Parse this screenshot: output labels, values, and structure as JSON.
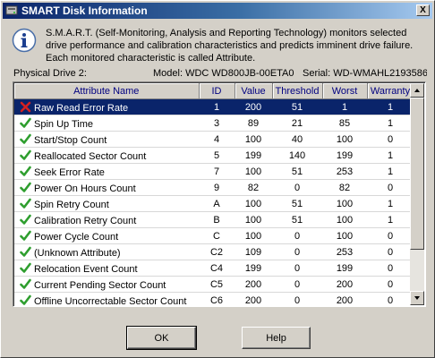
{
  "window": {
    "title": "SMART Disk Information",
    "close_label": "X"
  },
  "description": "S.M.A.R.T. (Self-Monitoring, Analysis and Reporting Technology) monitors selected drive performance and calibration characteristics and predicts imminent drive failure. Each monitored characteristic is called Attribute.",
  "drive": {
    "label": "Physical Drive 2:",
    "model": "Model: WDC WD800JB-00ETA0",
    "serial": "Serial: WD-WMAHL2193586"
  },
  "table": {
    "headers": [
      "Attribute Name",
      "ID",
      "Value",
      "Threshold",
      "Worst",
      "Warranty"
    ],
    "rows": [
      {
        "status": "error",
        "name": "Raw Read Error Rate",
        "id": "1",
        "value": "200",
        "threshold": "51",
        "worst": "1",
        "warranty": "1"
      },
      {
        "status": "ok",
        "name": "Spin Up Time",
        "id": "3",
        "value": "89",
        "threshold": "21",
        "worst": "85",
        "warranty": "1"
      },
      {
        "status": "ok",
        "name": "Start/Stop Count",
        "id": "4",
        "value": "100",
        "threshold": "40",
        "worst": "100",
        "warranty": "0"
      },
      {
        "status": "ok",
        "name": "Reallocated Sector Count",
        "id": "5",
        "value": "199",
        "threshold": "140",
        "worst": "199",
        "warranty": "1"
      },
      {
        "status": "ok",
        "name": "Seek Error Rate",
        "id": "7",
        "value": "100",
        "threshold": "51",
        "worst": "253",
        "warranty": "1"
      },
      {
        "status": "ok",
        "name": "Power On Hours Count",
        "id": "9",
        "value": "82",
        "threshold": "0",
        "worst": "82",
        "warranty": "0"
      },
      {
        "status": "ok",
        "name": "Spin Retry Count",
        "id": "A",
        "value": "100",
        "threshold": "51",
        "worst": "100",
        "warranty": "1"
      },
      {
        "status": "ok",
        "name": "Calibration Retry Count",
        "id": "B",
        "value": "100",
        "threshold": "51",
        "worst": "100",
        "warranty": "1"
      },
      {
        "status": "ok",
        "name": "Power Cycle Count",
        "id": "C",
        "value": "100",
        "threshold": "0",
        "worst": "100",
        "warranty": "0"
      },
      {
        "status": "ok",
        "name": "(Unknown Attribute)",
        "id": "C2",
        "value": "109",
        "threshold": "0",
        "worst": "253",
        "warranty": "0"
      },
      {
        "status": "ok",
        "name": "Relocation Event Count",
        "id": "C4",
        "value": "199",
        "threshold": "0",
        "worst": "199",
        "warranty": "0"
      },
      {
        "status": "ok",
        "name": "Current Pending Sector Count",
        "id": "C5",
        "value": "200",
        "threshold": "0",
        "worst": "200",
        "warranty": "0"
      },
      {
        "status": "ok",
        "name": "Offline Uncorrectable Sector Count",
        "id": "C6",
        "value": "200",
        "threshold": "0",
        "worst": "200",
        "warranty": "0"
      }
    ]
  },
  "buttons": {
    "ok": "OK",
    "help": "Help"
  },
  "icons": {
    "ok_status": "green-check-icon",
    "error_status": "red-x-icon",
    "info": "info-icon"
  },
  "colors": {
    "selection": "#0a246a",
    "check": "#2e9e2e",
    "error": "#d42020",
    "header_text": "#000080"
  }
}
